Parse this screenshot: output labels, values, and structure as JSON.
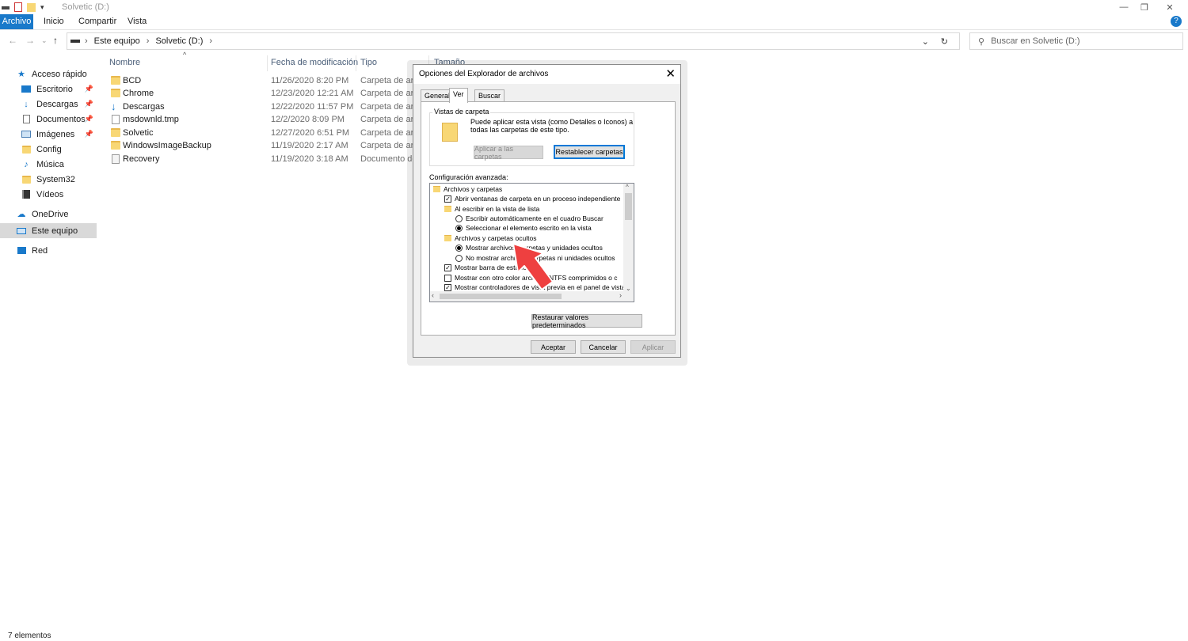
{
  "window": {
    "title": "Solvetic (D:)",
    "minimize_glyph": "—",
    "maximize_glyph": "❐",
    "close_glyph": "✕"
  },
  "ribbon": {
    "tabs": [
      "Archivo",
      "Inicio",
      "Compartir",
      "Vista"
    ],
    "help_glyph": "?"
  },
  "address": {
    "path": [
      "Este equipo",
      "Solvetic (D:)"
    ],
    "search_placeholder": "Buscar en Solvetic (D:)"
  },
  "sidebar": {
    "items": [
      {
        "label": "Acceso rápido",
        "icon": "star-icon",
        "pinned": false
      },
      {
        "label": "Escritorio",
        "icon": "desktop-icon",
        "pinned": true
      },
      {
        "label": "Descargas",
        "icon": "download-icon",
        "pinned": true
      },
      {
        "label": "Documentos",
        "icon": "document-icon",
        "pinned": true
      },
      {
        "label": "Imágenes",
        "icon": "pictures-icon",
        "pinned": true
      },
      {
        "label": "Config",
        "icon": "folder-icon",
        "pinned": false
      },
      {
        "label": "Música",
        "icon": "music-icon",
        "pinned": false
      },
      {
        "label": "System32",
        "icon": "folder-icon",
        "pinned": false
      },
      {
        "label": "Vídeos",
        "icon": "video-icon",
        "pinned": false
      },
      {
        "label": "OneDrive",
        "icon": "cloud-icon",
        "pinned": false
      },
      {
        "label": "Este equipo",
        "icon": "computer-icon",
        "pinned": false
      },
      {
        "label": "Red",
        "icon": "network-icon",
        "pinned": false
      }
    ]
  },
  "filelist": {
    "columns": [
      "Nombre",
      "Fecha de modificación",
      "Tipo",
      "Tamaño"
    ],
    "rows": [
      {
        "name": "BCD",
        "date": "11/26/2020 8:20 PM",
        "type": "Carpeta de arch",
        "icon": "folder-icon"
      },
      {
        "name": "Chrome",
        "date": "12/23/2020 12:21 AM",
        "type": "Carpeta de arch",
        "icon": "folder-icon"
      },
      {
        "name": "Descargas",
        "date": "12/22/2020 11:57 PM",
        "type": "Carpeta de arch",
        "icon": "download-icon"
      },
      {
        "name": "msdownld.tmp",
        "date": "12/2/2020 8:09 PM",
        "type": "Carpeta de arch",
        "icon": "folder-icon"
      },
      {
        "name": "Solvetic",
        "date": "12/27/2020 6:51 PM",
        "type": "Carpeta de arch",
        "icon": "folder-icon"
      },
      {
        "name": "WindowsImageBackup",
        "date": "11/19/2020 2:17 AM",
        "type": "Carpeta de arch",
        "icon": "folder-icon"
      },
      {
        "name": "Recovery",
        "date": "11/19/2020 3:18 AM",
        "type": "Documento de t",
        "icon": "file-icon"
      }
    ]
  },
  "status": {
    "count": "7 elementos"
  },
  "dialog": {
    "title": "Opciones del Explorador de archivos",
    "tabs": [
      "General",
      "Ver",
      "Buscar"
    ],
    "folder_views_label": "Vistas de carpeta",
    "folder_views_text_1": "Puede aplicar esta vista (como Detalles o Iconos) a",
    "folder_views_text_2": "todas las carpetas de este tipo.",
    "apply_folders_button": "Aplicar a las carpetas",
    "reset_folders_button": "Restablecer carpetas",
    "advanced_label": "Configuración avanzada:",
    "advanced_items": [
      {
        "kind": "folder",
        "indent": 0,
        "label": "Archivos y carpetas"
      },
      {
        "kind": "checkbox",
        "indent": 1,
        "checked": true,
        "label": "Abrir ventanas de carpeta  en un proceso independiente"
      },
      {
        "kind": "folder",
        "indent": 1,
        "label": "Al escribir en la vista de lista"
      },
      {
        "kind": "radio",
        "indent": 2,
        "checked": false,
        "label": "Escribir automáticamente en el cuadro Buscar"
      },
      {
        "kind": "radio",
        "indent": 2,
        "checked": true,
        "label": "Seleccionar el elemento escrito en la vista"
      },
      {
        "kind": "folder",
        "indent": 1,
        "label": "Archivos y carpetas ocultos"
      },
      {
        "kind": "radio",
        "indent": 2,
        "checked": true,
        "label": "Mostrar archivos, carpetas y unidades ocultos"
      },
      {
        "kind": "radio",
        "indent": 2,
        "checked": false,
        "label": "No mostrar archivos, carpetas ni unidades ocultos"
      },
      {
        "kind": "checkbox",
        "indent": 1,
        "checked": true,
        "label": "Mostrar barra de estado"
      },
      {
        "kind": "checkbox",
        "indent": 1,
        "checked": false,
        "label": "Mostrar con otro color archivos NTFS comprimidos o c"
      },
      {
        "kind": "checkbox",
        "indent": 1,
        "checked": true,
        "label": "Mostrar controladores de vista previa en el panel de vista"
      }
    ],
    "restore_defaults_button": "Restaurar valores predeterminados",
    "ok_button": "Aceptar",
    "cancel_button": "Cancelar",
    "apply_button": "Aplicar",
    "close_glyph": "✕"
  },
  "colors": {
    "accent": "#1979ca",
    "arrow": "#ee4040"
  }
}
